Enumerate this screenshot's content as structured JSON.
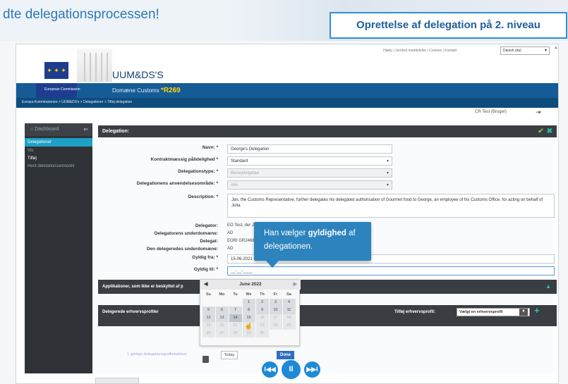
{
  "slide": {
    "title_left": "dte delegationsprocessen!",
    "title_right": "Oprettelse af delegation på 2. niveau"
  },
  "header": {
    "logo_text": "European Commission",
    "app_name": "UUM&DS'S",
    "domain_label": "Domæne Customs",
    "domain_version": "*R269",
    "top_links": "Hjælp | Juridisk meddelelse | Cookies | Kontakt",
    "language": "Danish (da)",
    "breadcrumb": "Europa-Kommissionen > UUM&DS's > Delegationer > Tilføj delegation",
    "user": "CR Test (Bruger)"
  },
  "sidebar": {
    "dashboard": "Dashboard",
    "items": [
      "Delegationer",
      "Vis",
      "Tilføj",
      "Hent deletationsanmodni"
    ]
  },
  "form": {
    "panel_title": "Delegation:",
    "name_label": "Navn: *",
    "name_value": "George's Delegation",
    "contract_label": "Kontraktmæssig pålidelighed *",
    "contract_value": "Standard",
    "type_label": "Delegationstype: *",
    "type_value": "Beneydelgetae",
    "scope_label": "Delegationens anvendelsesområde: *",
    "scope_value": "Alle",
    "description_label": "Description: *",
    "description_value": "Jan, the Customs Representative, further delegates his delegated authorisation of Gourmet food to George, an employee of his Customs Office, for acting on behalf of Julia.",
    "delegator_label": "Delegator:",
    "delegator_value": "EO Test, der Ju",
    "delegator_domain_label": "Delegatorens underdomæne:",
    "delegator_domain_value": "AD",
    "delegate_label": "Delegat:",
    "delegate_value": "EORI GR24681",
    "delegate_domain_label": "Den delegeredes underdomæne:",
    "delegate_domain_value": "AD",
    "valid_from_label": "Gyldig fra: *",
    "valid_from_value": "15-06-2021",
    "valid_to_label": "Gyldig til: *",
    "valid_to_value": "__-__-____",
    "apps_section": "Applikationer, som ikke er beskyttet af p",
    "profiles_section": "Delegerede erhvervsprofiler",
    "add_profile_label": "Tilføj erhvervsprofil:",
    "add_profile_value": "Vælgt en erhvervsprofil",
    "valid_links": "1 gyldige delegationsgodkendelser"
  },
  "datepicker": {
    "month": "June 2022",
    "weekdays": [
      "Su",
      "Mo",
      "Tu",
      "We",
      "Th",
      "Fr",
      "Sa"
    ],
    "weeks": [
      [
        "",
        "",
        "",
        "1",
        "2",
        "3",
        "4"
      ],
      [
        "5",
        "6",
        "7",
        "8",
        "9",
        "10",
        "11"
      ],
      [
        "12",
        "13",
        "14",
        "15",
        "16",
        "17",
        "18"
      ],
      [
        "19",
        "20",
        "21",
        "22",
        "23",
        "24",
        "25"
      ],
      [
        "26",
        "27",
        "28",
        "29",
        "30",
        "",
        ""
      ]
    ],
    "today_btn": "Today",
    "done_btn": "Done"
  },
  "tooltip": {
    "part1": "Han vælger ",
    "bold": "gyldighed",
    "part2": " af delegationen."
  },
  "video": {
    "rewind": "I◀◀",
    "pause": "II",
    "forward": "▶▶I"
  }
}
